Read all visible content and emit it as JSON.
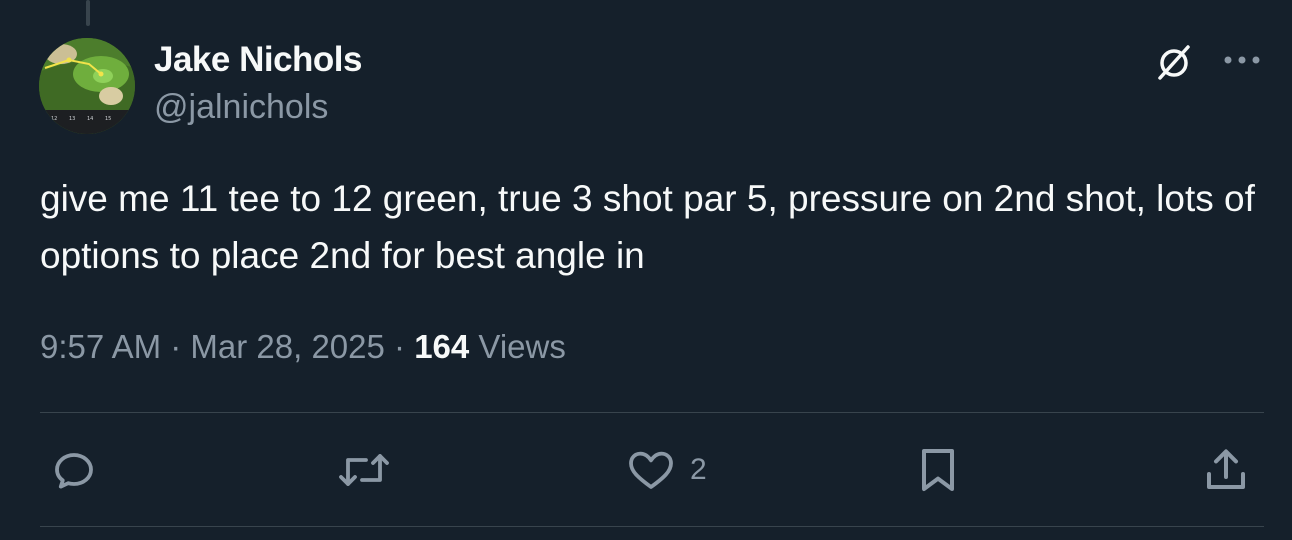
{
  "author": {
    "display_name": "Jake Nichols",
    "handle": "@jalnichols"
  },
  "tweet": {
    "text": "give me 11 tee to 12 green, true 3 shot par 5, pressure on 2nd shot, lots of options to place 2nd for best angle in"
  },
  "meta": {
    "time": "9:57 AM",
    "separator_1": " · ",
    "date": "Mar 28, 2025",
    "separator_2": " · ",
    "views_count": "164",
    "views_label": " Views"
  },
  "actions": {
    "reply": {
      "icon": "reply-icon",
      "count": ""
    },
    "retweet": {
      "icon": "retweet-icon",
      "count": ""
    },
    "like": {
      "icon": "heart-icon",
      "count": "2"
    },
    "bookmark": {
      "icon": "bookmark-icon",
      "count": ""
    },
    "share": {
      "icon": "share-icon",
      "count": ""
    }
  },
  "avatar_map": {
    "hole_labels": [
      "12",
      "13",
      "14",
      "15"
    ]
  },
  "colors": {
    "background": "#15202b",
    "text_primary": "#f7f9f9",
    "text_secondary": "#8b98a5",
    "divider": "#38444d"
  }
}
